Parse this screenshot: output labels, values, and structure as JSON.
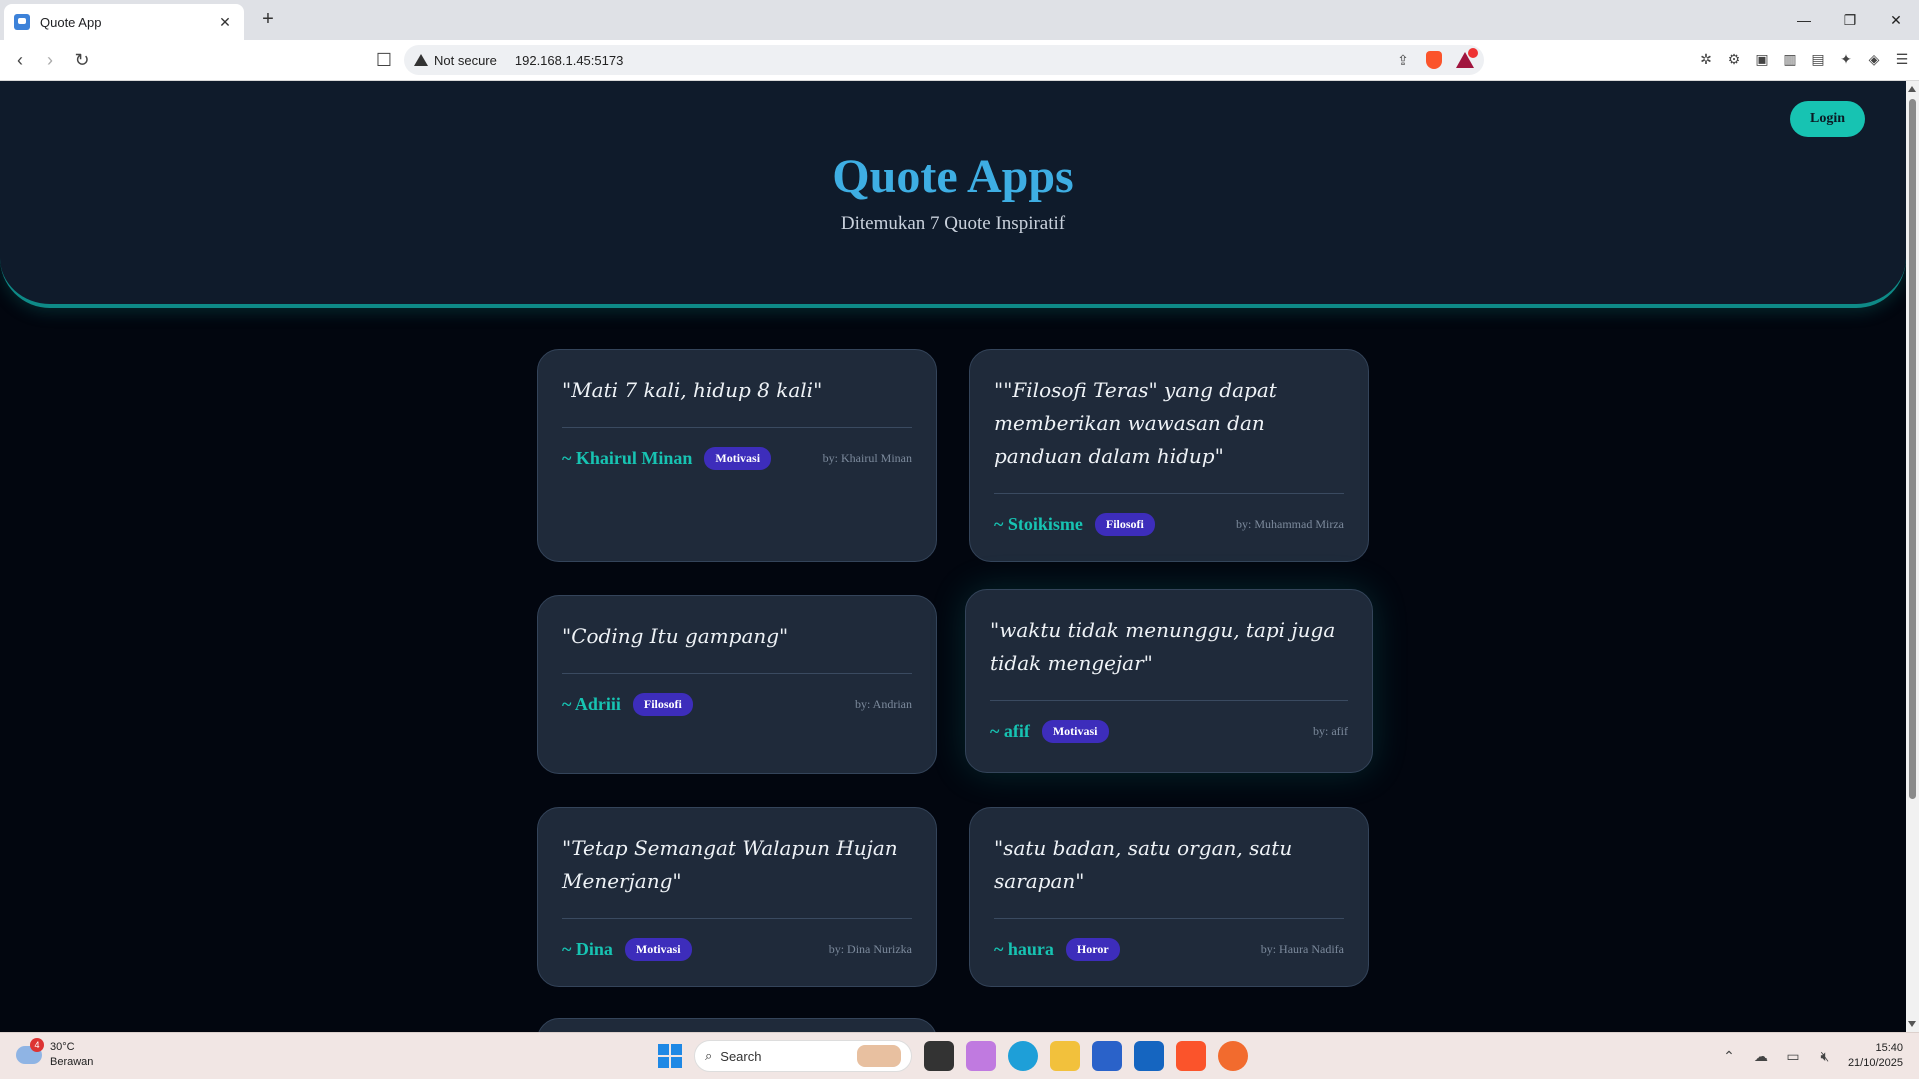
{
  "browser": {
    "tab_title": "Quote App",
    "new_tab": "+",
    "security_label": "Not secure",
    "url": "192.168.1.45:5173",
    "rewards_badge": "1"
  },
  "page": {
    "login_label": "Login",
    "title": "Quote Apps",
    "subtitle": "Ditemukan 7 Quote Inspiratif",
    "quotes": [
      {
        "text": "\"Mati 7 kali, hidup 8 kali\"",
        "author": "~ Khairul Minan",
        "tag": "Motivasi",
        "by": "by: Khairul Minan"
      },
      {
        "text": "\"\"Filosofi Teras\" yang dapat memberikan wawasan dan panduan dalam hidup\"",
        "author": "~ Stoikisme",
        "tag": "Filosofi",
        "by": "by: Muhammad Mirza"
      },
      {
        "text": "\"Coding Itu gampang\"",
        "author": "~ Adriii",
        "tag": "Filosofi",
        "by": "by: Andrian"
      },
      {
        "text": "\"waktu tidak menunggu, tapi juga tidak mengejar\"",
        "author": "~ afif",
        "tag": "Motivasi",
        "by": "by: afif"
      },
      {
        "text": "\"Tetap Semangat Walapun Hujan Menerjang\"",
        "author": "~ Dina",
        "tag": "Motivasi",
        "by": "by: Dina Nurizka"
      },
      {
        "text": "\"satu badan, satu organ, satu sarapan\"",
        "author": "~ haura",
        "tag": "Horor",
        "by": "by: Haura Nadifa"
      }
    ]
  },
  "taskbar": {
    "weather_badge": "4",
    "temperature": "30°C",
    "condition": "Berawan",
    "search_placeholder": "Search",
    "time": "15:40",
    "date": "21/10/2025"
  },
  "colors": {
    "accent": "#17c3b2",
    "title": "#3eaee3",
    "tag": "#3d2dbb",
    "card": "#1f2a3a",
    "hero": "#0f1b2b"
  }
}
